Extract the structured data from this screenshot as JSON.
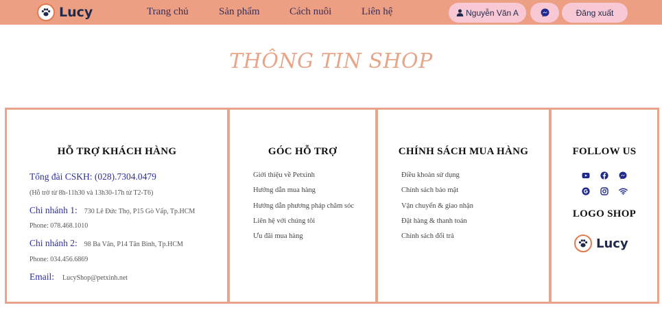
{
  "header": {
    "logo_text": "Lucy",
    "nav": {
      "home": "Trang chủ",
      "products": "Sản phẩm",
      "care": "Cách nuôi",
      "contact": "Liên hệ"
    },
    "user_name": "Nguyễn Văn A",
    "logout": "Đăng xuất"
  },
  "page_title": "THÔNG TIN SHOP",
  "support": {
    "heading": "HỖ TRỢ KHÁCH HÀNG",
    "hotline": "Tổng đài CSKH: (028).7304.0479",
    "hours": "(Hỗ trờ từ 8h-11h30 và 13h30-17h từ T2-T6)",
    "branch1_label": "Chi nhánh 1:",
    "branch1_address": "730 Lê Đức Thọ, P15 Gò Vấp, Tp.HCM",
    "branch1_phone": "Phone: 078.468.1010",
    "branch2_label": "Chi nhánh 2:",
    "branch2_address": "98 Ba Vân, P14 Tân Bình, Tp.HCM",
    "branch2_phone": "Phone: 034.456.6869",
    "email_label": "Email:",
    "email_value": "LucyShop@petxinh.net"
  },
  "help_corner": {
    "heading": "GÓC HỖ TRỢ",
    "links": [
      "Giới thiệu về Petxinh",
      "Hướng dẫn mua hàng",
      "Hướng dẫn phương pháp chăm sóc",
      "Liên hệ với chúng tôi",
      "Ưu đãi mua hàng"
    ]
  },
  "policy": {
    "heading": "CHÍNH SÁCH MUA HÀNG",
    "links": [
      "Điều khoản sử dụng",
      "Chính sách bảo mật",
      "Vận chuyển & giao nhận",
      "Đặt hàng & thanh toán",
      "Chính sách đổi trả"
    ]
  },
  "follow": {
    "heading": "FOLLOW US",
    "icons_row1": [
      "youtube-icon",
      "facebook-icon",
      "messenger-icon"
    ],
    "icons_row2": [
      "google-icon",
      "instagram-icon",
      "wifi-icon"
    ],
    "logo_heading": "LOGO SHOP",
    "logo_text": "Lucy"
  },
  "colors": {
    "header_bg": "#ec9f82",
    "pill_bg": "#f8c8d4",
    "title": "#e7a689",
    "border": "#e9a48a",
    "link_blue": "#2c2f9c",
    "icon_blue": "#1f2a8c"
  }
}
